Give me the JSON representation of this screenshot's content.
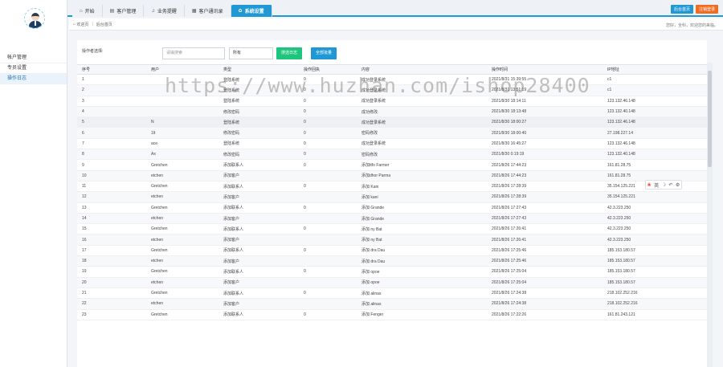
{
  "tabs": [
    {
      "label": "开始",
      "icon": "home-icon",
      "active": false
    },
    {
      "label": "客户管理",
      "icon": "document-icon",
      "active": false
    },
    {
      "label": "业务提醒",
      "icon": "bell-icon",
      "active": false
    },
    {
      "label": "客户通讯录",
      "icon": "contacts-icon",
      "active": false
    },
    {
      "label": "系统设置",
      "icon": "gear-icon",
      "active": true
    }
  ],
  "header": {
    "home_label": "后台首页",
    "logout_label": "注销登录"
  },
  "sidebar": {
    "items": [
      {
        "label": "帐户管理",
        "active": false
      },
      {
        "label": "专员设置",
        "active": false
      },
      {
        "label": "操作日志",
        "active": true
      }
    ]
  },
  "breadcrumb": {
    "home": "欢迎页",
    "current": "后台首页",
    "greeting": "您好，全科，欢迎您的来临。"
  },
  "filter": {
    "label": "操作者选择:",
    "keyword_placeholder": "请输搜索",
    "type_value": "所有",
    "search_button": "搜选日志",
    "delete_button": "全部批量"
  },
  "table": {
    "columns": [
      "序号",
      "用户",
      "类型",
      "操作回执",
      "内容",
      "操作时间",
      "IP地址"
    ],
    "rows": [
      [
        "1",
        "",
        "登陆系统",
        "0",
        "成功登录系统",
        "2021/8/31 15:39:55",
        "c1"
      ],
      [
        "2",
        "",
        "登陆系统",
        "0",
        "成功登录系统",
        "2021/8/31 13:51:19",
        "c1"
      ],
      [
        "3",
        "",
        "登陆系统",
        "0",
        "成功登录系统",
        "2021/8/30 18:14:11",
        "123.132.46.148"
      ],
      [
        "4",
        "",
        "修改密码",
        "0",
        "成功修改",
        "2021/8/30 18:13:48",
        "123.132.40.148"
      ],
      [
        "5",
        "N",
        "登陆系统",
        "0",
        "成功登录系统",
        "2021/8/30 18:00:27",
        "123.132.46.148"
      ],
      [
        "6",
        "1lt",
        "修改密码",
        "0",
        "密码修改",
        "2021/8/30 18:00:40",
        "27.198.227.14"
      ],
      [
        "7",
        "ace",
        "登陆系统",
        "0",
        "成功登录系统",
        "2021/8/30 16:45:27",
        "123.132.46.148"
      ],
      [
        "8",
        "Ax",
        "修改密码",
        "0",
        "密码修改",
        "2021/8/30 0:19:19",
        "123.132.40.148"
      ],
      [
        "9",
        "Gretchen",
        "添加联系人",
        "0",
        "添加ttfo Farmer",
        "2021/8/26 17:44:23",
        "161.81.28.75"
      ],
      [
        "10",
        "etchen",
        "添加客户",
        "",
        "添加dhor Parma",
        "2021/8/26 17:44:23",
        "161.81.28.75"
      ],
      [
        "11",
        "Gretchen",
        "添加联系人",
        "0",
        "添加 Kani",
        "2021/8/26 17:28:39",
        "35.154.125.221"
      ],
      [
        "12",
        "etchen",
        "添加客户",
        "",
        "添加 kani",
        "2021/8/26 17:28:39",
        "35.154.125.221"
      ],
      [
        "13",
        "Gretchen",
        "添加联系人",
        "0",
        "添加 Grande",
        "2021/8/26 17:27:43",
        "42.3.223.250"
      ],
      [
        "14",
        "etchen",
        "添加客户",
        "",
        "添加 Grande",
        "2021/8/26 17:27:43",
        "42.3.223.250"
      ],
      [
        "15",
        "Gretchen",
        "添加联系人",
        "0",
        "添加 ny Bat",
        "2021/8/26 17:26:41",
        "42.3.223.250"
      ],
      [
        "16",
        "etchen",
        "添加客户",
        "",
        "添加 ny Bat",
        "2021/8/26 17:26:41",
        "42.3.223.250"
      ],
      [
        "17",
        "Gretchen",
        "添加联系人",
        "0",
        "添加 dra Dau",
        "2021/8/26 17:25:46",
        "185.153.180.57"
      ],
      [
        "18",
        "etchen",
        "添加客户",
        "",
        "添加 dra Dau",
        "2021/8/26 17:25:46",
        "185.153.180.57"
      ],
      [
        "19",
        "Gretchen",
        "添加联系人",
        "0",
        "添加 opoe",
        "2021/8/26 17:25:04",
        "185.153.180.57"
      ],
      [
        "20",
        "etchen",
        "添加客户",
        "",
        "添加 opoe",
        "2021/8/26 17:25:04",
        "185.153.180.57"
      ],
      [
        "21",
        "Gretchen",
        "添加联系人",
        "0",
        "添加 alinas",
        "2021/8/26 17:24:38",
        "218.102.252.216"
      ],
      [
        "22",
        "etchen",
        "添加客户",
        "",
        "添加 alinas",
        "2021/8/26 17:24:38",
        "218.102.252.216"
      ],
      [
        "23",
        "Gretchen",
        "添加联系人",
        "0",
        "添加 Fenger",
        "2021/8/26 17:22:26",
        "161.81.243.121"
      ]
    ]
  },
  "widget": {
    "items": [
      "英",
      "☽",
      "↶",
      "⚙"
    ]
  },
  "watermark": "https://www.huzhan.com/ishop28400"
}
